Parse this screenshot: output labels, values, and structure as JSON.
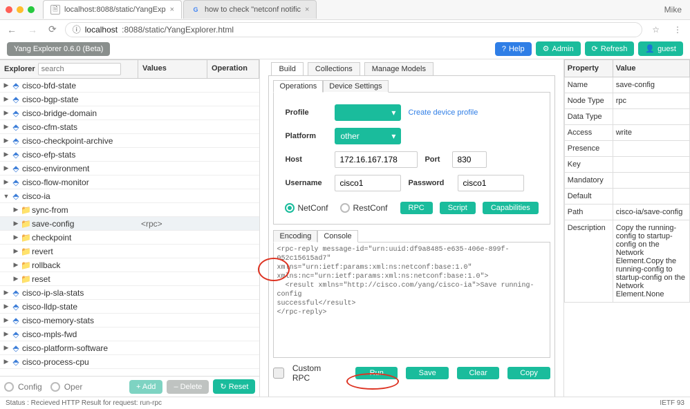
{
  "chrome": {
    "tabs": [
      {
        "title": "localhost:8088/static/YangExp"
      },
      {
        "title": "how to check \"netconf notific"
      }
    ],
    "user": "Mike",
    "url_host": "localhost",
    "url_path": ":8088/static/YangExplorer.html",
    "info_icon": "ⓘ"
  },
  "header": {
    "app_title": "Yang Explorer 0.6.0 (Beta)",
    "help": "Help",
    "admin": "Admin",
    "refresh": "Refresh",
    "guest": "guest"
  },
  "explorer": {
    "headers": {
      "explorer": "Explorer",
      "values": "Values",
      "operation": "Operation"
    },
    "search_placeholder": "search",
    "nodes": [
      {
        "label": "cisco-bfd-state",
        "icon": "module",
        "twisty": "▶",
        "indent": 0
      },
      {
        "label": "cisco-bgp-state",
        "icon": "module",
        "twisty": "▶",
        "indent": 0
      },
      {
        "label": "cisco-bridge-domain",
        "icon": "module",
        "twisty": "▶",
        "indent": 0
      },
      {
        "label": "cisco-cfm-stats",
        "icon": "module",
        "twisty": "▶",
        "indent": 0
      },
      {
        "label": "cisco-checkpoint-archive",
        "icon": "module",
        "twisty": "▶",
        "indent": 0
      },
      {
        "label": "cisco-efp-stats",
        "icon": "module",
        "twisty": "▶",
        "indent": 0
      },
      {
        "label": "cisco-environment",
        "icon": "module",
        "twisty": "▶",
        "indent": 0
      },
      {
        "label": "cisco-flow-monitor",
        "icon": "module",
        "twisty": "▶",
        "indent": 0
      },
      {
        "label": "cisco-ia",
        "icon": "module",
        "twisty": "▼",
        "indent": 0
      },
      {
        "label": "sync-from",
        "icon": "rpc",
        "twisty": "▶",
        "indent": 1
      },
      {
        "label": "save-config",
        "icon": "rpc",
        "twisty": "▶",
        "indent": 1,
        "value": "<rpc>",
        "selected": true
      },
      {
        "label": "checkpoint",
        "icon": "rpc",
        "twisty": "▶",
        "indent": 1
      },
      {
        "label": "revert",
        "icon": "rpc",
        "twisty": "▶",
        "indent": 1
      },
      {
        "label": "rollback",
        "icon": "rpc",
        "twisty": "▶",
        "indent": 1
      },
      {
        "label": "reset",
        "icon": "rpc",
        "twisty": "▶",
        "indent": 1
      },
      {
        "label": "cisco-ip-sla-stats",
        "icon": "module",
        "twisty": "▶",
        "indent": 0
      },
      {
        "label": "cisco-lldp-state",
        "icon": "module",
        "twisty": "▶",
        "indent": 0
      },
      {
        "label": "cisco-memory-stats",
        "icon": "module",
        "twisty": "▶",
        "indent": 0
      },
      {
        "label": "cisco-mpls-fwd",
        "icon": "module",
        "twisty": "▶",
        "indent": 0
      },
      {
        "label": "cisco-platform-software",
        "icon": "module",
        "twisty": "▶",
        "indent": 0
      },
      {
        "label": "cisco-process-cpu",
        "icon": "module",
        "twisty": "▶",
        "indent": 0
      }
    ],
    "footer": {
      "config": "Config",
      "oper": "Oper",
      "add": "+ Add",
      "delete": "– Delete",
      "reset": "↻ Reset"
    }
  },
  "center": {
    "tabs": {
      "build": "Build",
      "collections": "Collections",
      "manage": "Manage Models"
    },
    "subtabs": {
      "operations": "Operations",
      "device": "Device Settings"
    },
    "form": {
      "profile_label": "Profile",
      "profile_value": " ",
      "create_profile_link": "Create device profile",
      "platform_label": "Platform",
      "platform_value": "other",
      "host_label": "Host",
      "host_value": "172.16.167.178",
      "port_label": "Port",
      "port_value": "830",
      "username_label": "Username",
      "username_value": "cisco1",
      "password_label": "Password",
      "password_value": "cisco1"
    },
    "conn": {
      "netconf": "NetConf",
      "restconf": "RestConf"
    },
    "actions": {
      "rpc": "RPC",
      "script": "Script",
      "caps": "Capabilities"
    },
    "enc_tabs": {
      "encoding": "Encoding",
      "console": "Console"
    },
    "console_text": "<rpc-reply message-id=\"urn:uuid:df9a8485-e635-406e-899f-052c15615ad7\"\nxmlns=\"urn:ietf:params:xml:ns:netconf:base:1.0\"\nxmlns:nc=\"urn:ietf:params:xml:ns:netconf:base:1.0\">\n  <result xmlns=\"http://cisco.com/yang/cisco-ia\">Save running-config\nsuccessful</result>\n</rpc-reply>",
    "bottom": {
      "custom_rpc": "Custom RPC",
      "run": "Run",
      "save": "Save",
      "clear": "Clear",
      "copy": "Copy"
    }
  },
  "properties": {
    "headers": {
      "property": "Property",
      "value": "Value"
    },
    "rows": [
      {
        "prop": "Name",
        "val": "save-config"
      },
      {
        "prop": "Node Type",
        "val": "rpc"
      },
      {
        "prop": "Data Type",
        "val": ""
      },
      {
        "prop": "Access",
        "val": "write"
      },
      {
        "prop": "Presence",
        "val": ""
      },
      {
        "prop": "Key",
        "val": ""
      },
      {
        "prop": "Mandatory",
        "val": ""
      },
      {
        "prop": "Default",
        "val": ""
      },
      {
        "prop": "Path",
        "val": "cisco-ia/save-config"
      },
      {
        "prop": "Description",
        "val": "Copy the running-config to startup-config on the Network Element.Copy the running-config to startup-config on the Network Element.None"
      }
    ]
  },
  "status": {
    "text": "Status : Recieved HTTP Result for request: run-rpc",
    "right": "IETF 93"
  }
}
